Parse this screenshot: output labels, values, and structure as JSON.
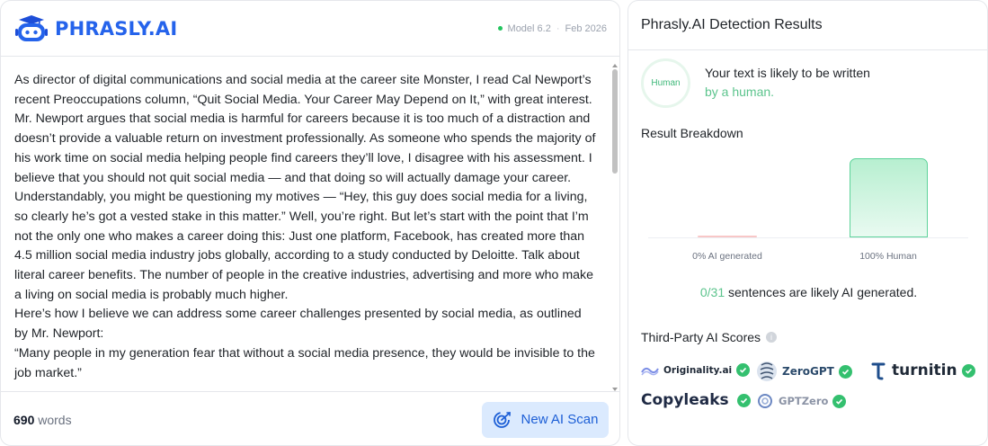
{
  "brand": {
    "logo_text": "PHRASLY.AI"
  },
  "model": {
    "version": "Model 6.2",
    "date": "Feb 2026"
  },
  "paragraphs": [
    "As director of digital communications and social media at the career site Monster, I read Cal Newport’s recent Preoccupations column, “Quit Social Media. Your Career May Depend on It,” with great interest. Mr. Newport argues that social media is harmful for careers because it is too much of a distraction and doesn’t provide a valuable return on investment professionally. As someone who spends the majority of his work time on social media helping people find careers they’ll love, I disagree with his assessment. I believe that you should not quit social media — and that doing so will actually damage your career.",
    "Understandably, you might be questioning my motives — “Hey, this guy does social media for a living, so clearly he’s got a vested stake in this matter.” Well, you’re right. But let’s start with the point that I’m not the only one who makes a career doing this: Just one platform, Facebook, has created more than 4.5 million social media industry jobs globally, according to a study conducted by Deloitte. Talk about literal career benefits. The number of people in the creative industries, advertising and more who make a living on social media is probably much higher.",
    "Here’s how I believe we can address some career challenges presented by social media, as outlined by Mr. Newport:",
    "“Many people in my generation fear that without a social media presence, they would be invisible to the job market.”"
  ],
  "footer": {
    "word_count": "690",
    "word_unit": "words",
    "scan_label": "New AI Scan"
  },
  "results": {
    "title": "Phrasly.AI Detection Results",
    "badge": "Human",
    "verdict_line1": "Your text is likely to be written",
    "verdict_line2": "by a human.",
    "breakdown_title": "Result Breakdown",
    "ai_label": "0% AI generated",
    "human_label": "100% Human",
    "ai_fraction": 0,
    "human_fraction": 1,
    "sentences_count": "0/31",
    "sentences_mid": "sentences are likely",
    "sentences_end": "AI generated.",
    "third_party_title": "Third-Party AI Scores",
    "providers": [
      "Originality.ai",
      "ZeroGPT",
      "turnitin",
      "Copyleaks",
      "GPTZero"
    ]
  },
  "colors": {
    "accent": "#2563eb",
    "human_green": "#5cc48d",
    "check_green": "#34c06f"
  }
}
